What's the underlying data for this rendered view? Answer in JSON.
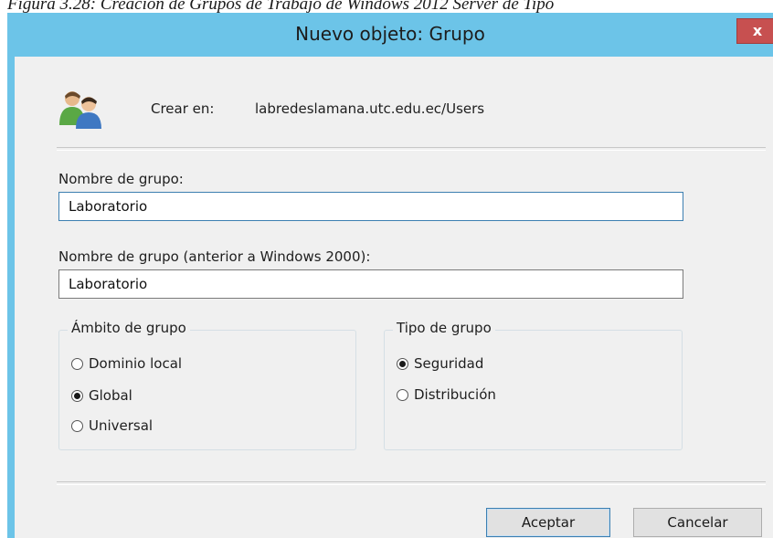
{
  "caption": "Figura 3.28: Creación de Grupos de Trabajo de Windows 2012 Server de Tipo",
  "window": {
    "title": "Nuevo objeto: Grupo",
    "close_glyph": "x"
  },
  "create_in": {
    "label": "Crear en:",
    "path": "labredeslamana.utc.edu.ec/Users",
    "icon": "users-group-icon"
  },
  "group_name": {
    "label": "Nombre de grupo:",
    "value": "Laboratorio"
  },
  "group_name_pre2000": {
    "label": "Nombre de grupo (anterior a Windows 2000):",
    "value": "Laboratorio"
  },
  "scope": {
    "legend": "Ámbito de grupo",
    "options": [
      "Dominio local",
      "Global",
      "Universal"
    ],
    "selected": "Global"
  },
  "type": {
    "legend": "Tipo de grupo",
    "options": [
      "Seguridad",
      "Distribución"
    ],
    "selected": "Seguridad"
  },
  "buttons": {
    "ok": "Aceptar",
    "cancel": "Cancelar"
  },
  "colors": {
    "titlebar": "#6cc4e8",
    "close_button": "#c75050",
    "client_background": "#f0f0f0"
  }
}
